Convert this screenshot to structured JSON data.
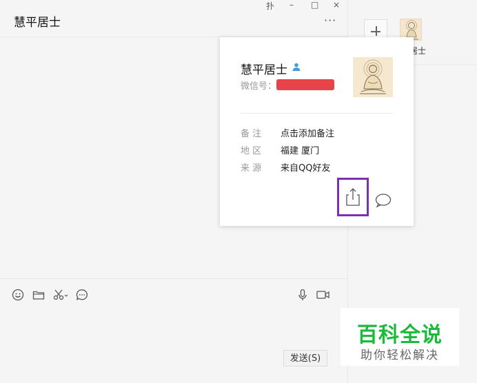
{
  "window": {
    "pin_glyph": "扑",
    "minimize_glyph": "–",
    "maximize_glyph": "□",
    "close_glyph": "×"
  },
  "chat": {
    "title": "慧平居士",
    "more_glyph": "···",
    "send_label": "发送(S)"
  },
  "sidebar": {
    "contact_name": "居士"
  },
  "profile_card": {
    "name": "慧平居士",
    "wechat_id_label": "微信号：",
    "fields": [
      {
        "label": "备  注",
        "value": "点击添加备注"
      },
      {
        "label": "地  区",
        "value": "福建  厦门"
      },
      {
        "label": "来  源",
        "value": "来自QQ好友"
      }
    ]
  },
  "watermark": {
    "title": "百科全说",
    "subtitle": "助你轻松解决"
  },
  "colors": {
    "accent_highlight": "#7b2fb5",
    "redaction": "#e8434a",
    "watermark_green": "#1bba3a"
  }
}
